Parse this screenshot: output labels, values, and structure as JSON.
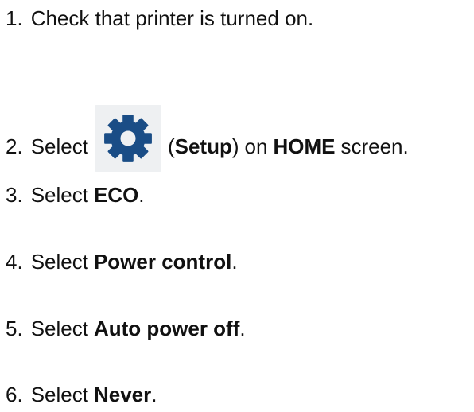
{
  "steps": [
    {
      "num": "1.",
      "text": "Check that printer is turned on."
    },
    {
      "num": "2.",
      "pre": "Select",
      "icon": "gear-icon",
      "paren_open": "(",
      "bold": "Setup",
      "paren_close": ")",
      "mid": "on",
      "bold2": "HOME",
      "post": "screen."
    },
    {
      "num": "3.",
      "pre": "Select",
      "bold": "ECO",
      "post": "."
    },
    {
      "num": "4.",
      "pre": "Select",
      "bold": "Power control",
      "post": "."
    },
    {
      "num": "5.",
      "pre": "Select",
      "bold": "Auto power off",
      "post": "."
    },
    {
      "num": "6.",
      "pre": "Select",
      "bold": "Never",
      "post": "."
    }
  ],
  "colors": {
    "icon_gear": "#1a4d86",
    "icon_bg": "#eef0f2",
    "text": "#111111"
  }
}
